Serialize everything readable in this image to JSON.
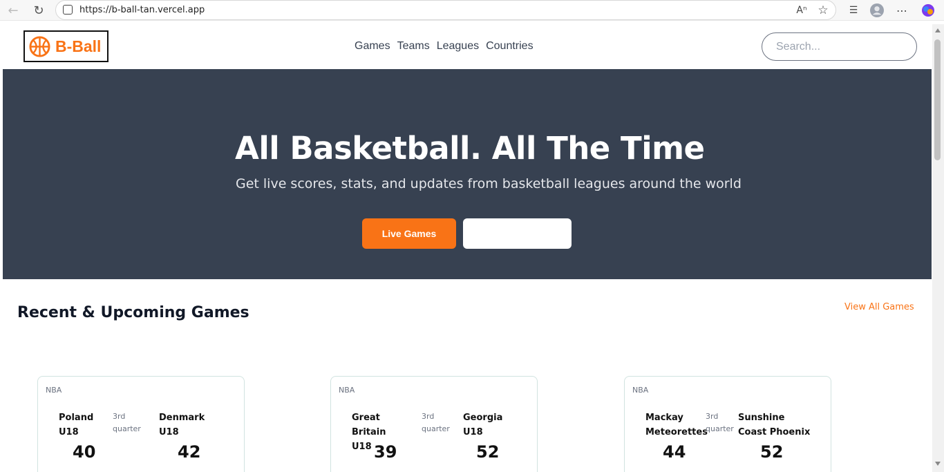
{
  "browser": {
    "url": "https://b-ball-tan.vercel.app"
  },
  "header": {
    "logo_text": "B-Ball",
    "nav": [
      "Games",
      "Teams",
      "Leagues",
      "Countries"
    ],
    "search_placeholder": "Search..."
  },
  "hero": {
    "title": "All Basketball. All The Time",
    "subtitle": "Get live scores, stats, and updates from basketball leagues around the world",
    "primary_button": "Live Games",
    "secondary_button": ""
  },
  "games_section": {
    "title": "Recent & Upcoming Games",
    "view_all": "View All Games",
    "games": [
      {
        "league": "NBA",
        "home_line1": "Poland",
        "home_line2": "U18",
        "status_line1": "3rd",
        "status_line2": "quarter",
        "away_line1": "Denmark",
        "away_line2": "U18",
        "home_score": "40",
        "away_score": "42"
      },
      {
        "league": "NBA",
        "home_line1": "Great Britain",
        "home_line2": "U18",
        "status_line1": "3rd",
        "status_line2": "quarter",
        "away_line1": "Georgia",
        "away_line2": "U18",
        "home_score": "39",
        "away_score": "52"
      },
      {
        "league": "NBA",
        "home_line1": "Mackay",
        "home_line2": "Meteorettes",
        "status_line1": "3rd",
        "status_line2": "quarter",
        "away_line1": "Sunshine",
        "away_line2": "Coast Phoenix",
        "home_score": "44",
        "away_score": "52"
      }
    ]
  },
  "colors": {
    "accent": "#f97316",
    "hero_bg": "#374151"
  }
}
